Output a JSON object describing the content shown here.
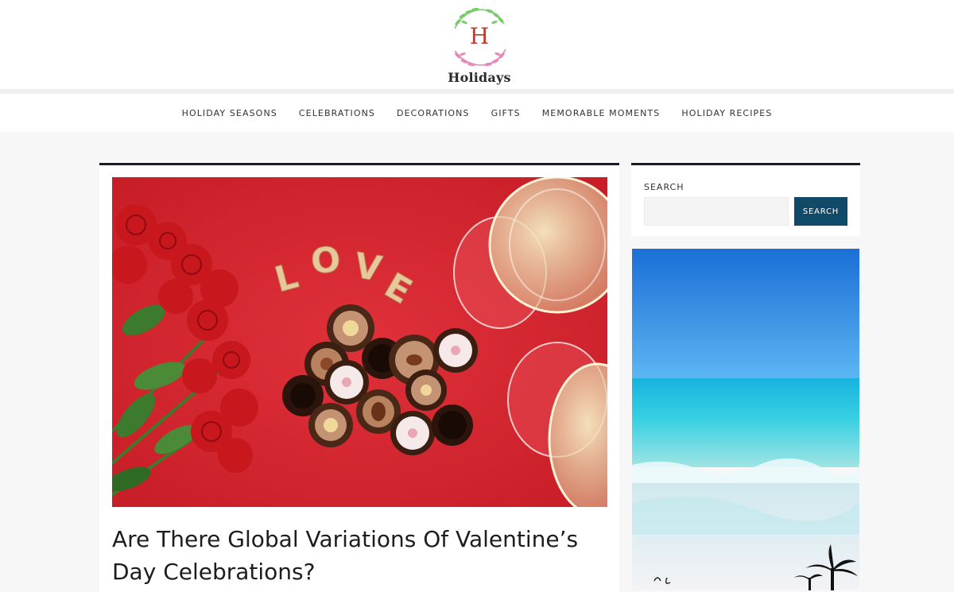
{
  "site": {
    "logo_letter": "H",
    "name": "Holidays",
    "colors": {
      "logo_letter": "#c0392b",
      "leaf_green": "#7ac96a",
      "leaf_pink": "#e48ab8"
    }
  },
  "nav": {
    "items": [
      {
        "label": "HOLIDAY SEASONS"
      },
      {
        "label": "CELEBRATIONS"
      },
      {
        "label": "DECORATIONS"
      },
      {
        "label": "GIFTS"
      },
      {
        "label": "MEMORABLE MOMENTS"
      },
      {
        "label": "HOLIDAY RECIPES"
      }
    ]
  },
  "post": {
    "image_text": "LOVE",
    "title": "Are There Global Variations Of Valentine’s Day Celebrations?"
  },
  "sidebar": {
    "search": {
      "label": "SEARCH",
      "button_label": "SEARCH",
      "input_value": ""
    }
  },
  "theme": {
    "accent": "#104a68",
    "card_border": "#1c1c28",
    "page_bg": "#f7f7f7"
  }
}
